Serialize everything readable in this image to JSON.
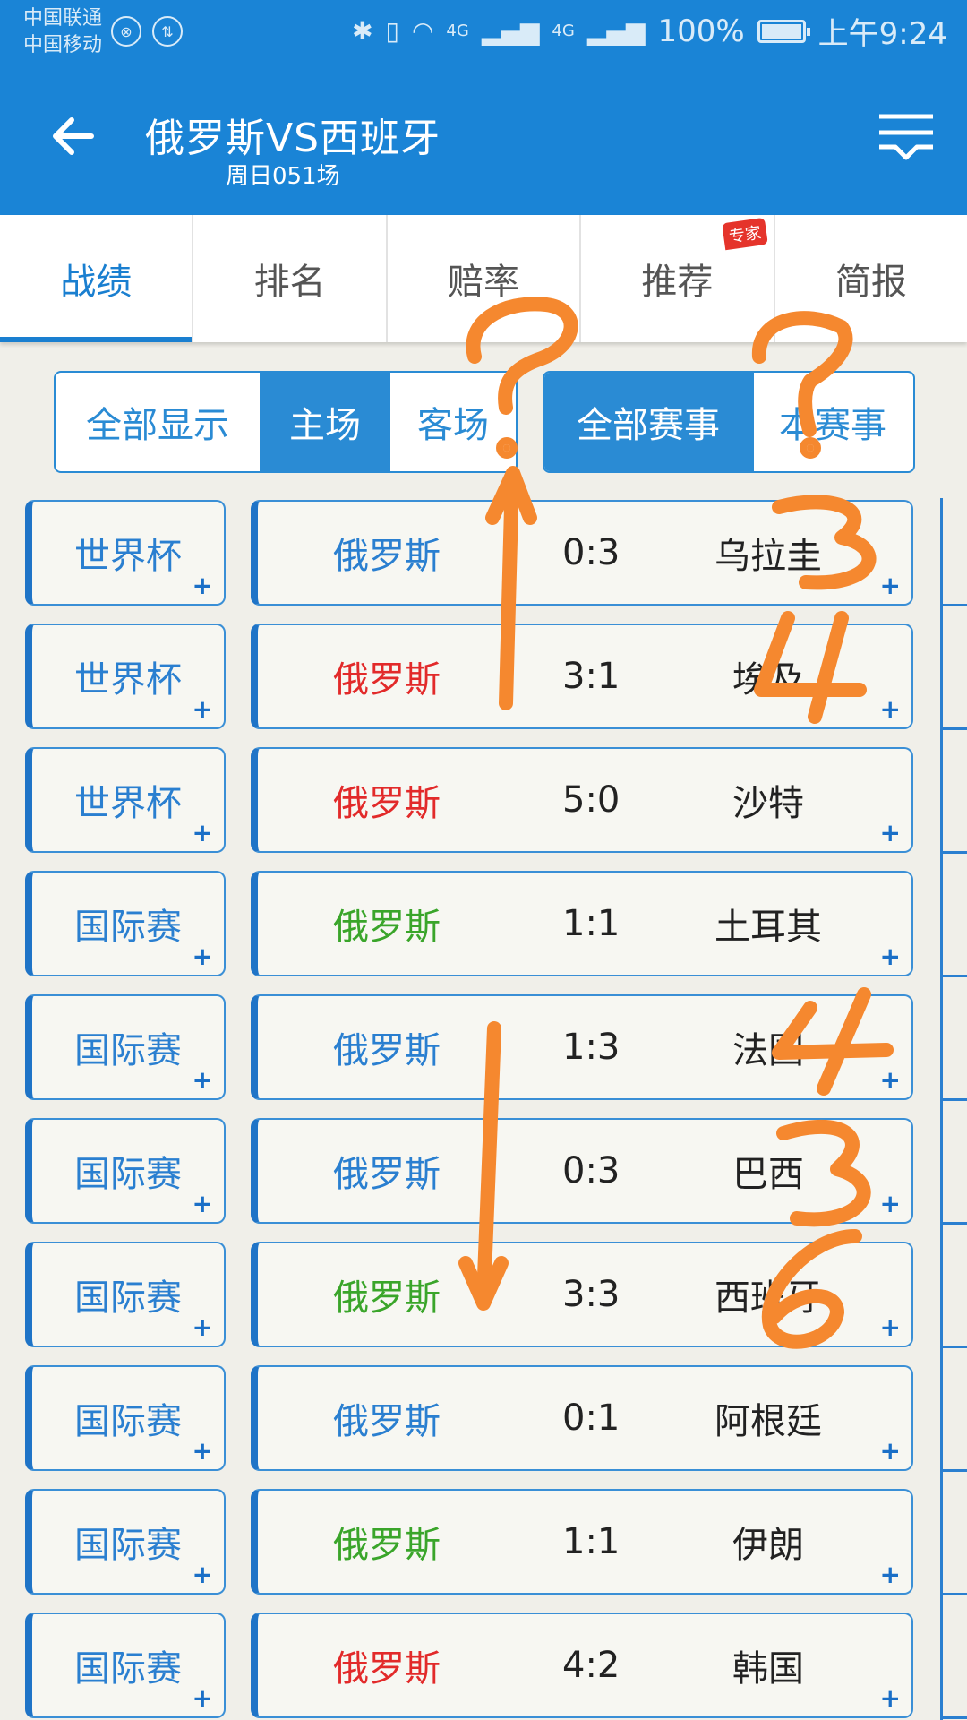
{
  "statusbar": {
    "carrier1": "中国联通",
    "carrier2": "中国移动",
    "net_labels": [
      "4G",
      "4G"
    ],
    "battery": "100%",
    "time": "上午9:24"
  },
  "header": {
    "title": "俄罗斯VS西班牙",
    "subtitle": "周日051场"
  },
  "tabs": [
    {
      "label": "战绩",
      "active": true
    },
    {
      "label": "排名",
      "active": false
    },
    {
      "label": "赔率",
      "active": false
    },
    {
      "label": "推荐",
      "active": false,
      "badge": "专家"
    },
    {
      "label": "简报",
      "active": false
    }
  ],
  "filters": {
    "venue": [
      "全部显示",
      "主场",
      "客场"
    ],
    "venue_selected": "主场",
    "competition": [
      "全部赛事",
      "本赛事"
    ],
    "competition_selected": "全部赛事"
  },
  "matches": [
    {
      "league": "世界杯",
      "home": "俄罗斯",
      "score": "0:3",
      "away": "乌拉圭",
      "result": "loss"
    },
    {
      "league": "世界杯",
      "home": "俄罗斯",
      "score": "3:1",
      "away": "埃及",
      "result": "win"
    },
    {
      "league": "世界杯",
      "home": "俄罗斯",
      "score": "5:0",
      "away": "沙特",
      "result": "win"
    },
    {
      "league": "国际赛",
      "home": "俄罗斯",
      "score": "1:1",
      "away": "土耳其",
      "result": "draw"
    },
    {
      "league": "国际赛",
      "home": "俄罗斯",
      "score": "1:3",
      "away": "法国",
      "result": "loss"
    },
    {
      "league": "国际赛",
      "home": "俄罗斯",
      "score": "0:3",
      "away": "巴西",
      "result": "loss"
    },
    {
      "league": "国际赛",
      "home": "俄罗斯",
      "score": "3:3",
      "away": "西班牙",
      "result": "draw"
    },
    {
      "league": "国际赛",
      "home": "俄罗斯",
      "score": "0:1",
      "away": "阿根廷",
      "result": "loss"
    },
    {
      "league": "国际赛",
      "home": "俄罗斯",
      "score": "1:1",
      "away": "伊朗",
      "result": "draw"
    },
    {
      "league": "国际赛",
      "home": "俄罗斯",
      "score": "4:2",
      "away": "韩国",
      "result": "win"
    }
  ],
  "plus_label": "+",
  "result_colors": {
    "win": "#e22a2a",
    "draw": "#3aa52a",
    "loss": "#2a7fd0"
  },
  "annotations": {
    "color": "#f5882f",
    "marks": [
      "?",
      "?",
      "3",
      "4",
      "4",
      "3",
      "6"
    ]
  }
}
